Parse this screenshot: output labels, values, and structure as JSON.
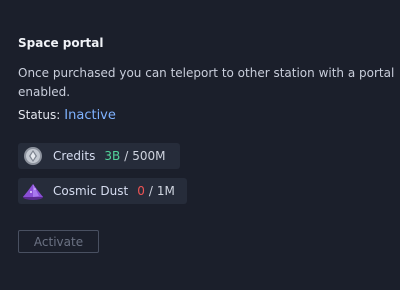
{
  "panel": {
    "title": "Space portal",
    "description": "Once purchased you can teleport to other station with a portal enabled.",
    "status_label": "Status:",
    "status_value": "Inactive"
  },
  "resources": [
    {
      "name": "Credits",
      "current": "3B",
      "separator": "/",
      "required": "500M",
      "icon": "credits-coin-icon",
      "current_color": "#52d39a"
    },
    {
      "name": "Cosmic Dust",
      "current": "0",
      "separator": "/",
      "required": "1M",
      "icon": "cosmic-dust-icon",
      "current_color": "#f05454"
    }
  ],
  "actions": {
    "activate_label": "Activate"
  }
}
